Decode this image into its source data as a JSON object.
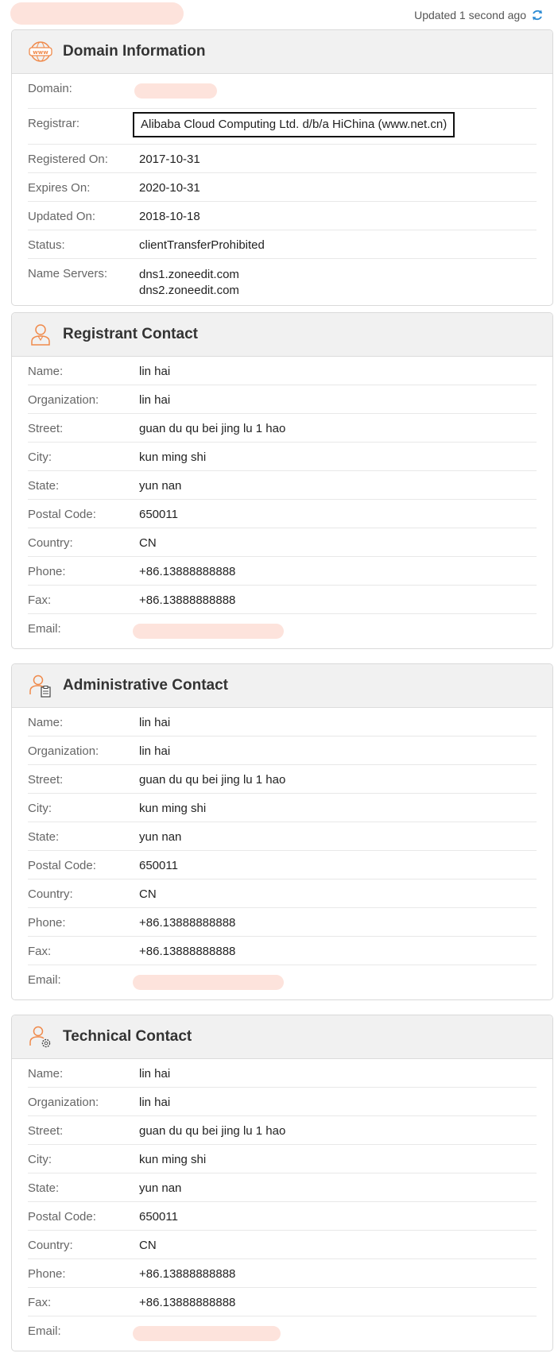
{
  "header": {
    "updated_text": "Updated 1 second ago",
    "refresh_icon": "refresh-icon"
  },
  "colors": {
    "accent": "#f08a4b",
    "redact": "#fde3dc",
    "refresh": "#2a8ad4"
  },
  "domain_info": {
    "title": "Domain Information",
    "icon": "www-icon",
    "rows": [
      {
        "label": "Domain:",
        "value": ""
      },
      {
        "label": "Registrar:",
        "value": "Alibaba Cloud Computing Ltd. d/b/a HiChina (www.net.cn)"
      },
      {
        "label": "Registered On:",
        "value": "2017-10-31"
      },
      {
        "label": "Expires On:",
        "value": "2020-10-31"
      },
      {
        "label": "Updated On:",
        "value": "2018-10-18"
      },
      {
        "label": "Status:",
        "value": "clientTransferProhibited"
      },
      {
        "label": "Name Servers:",
        "values": [
          "dns1.zoneedit.com",
          "dns2.zoneedit.com"
        ]
      }
    ]
  },
  "registrant": {
    "title": "Registrant Contact",
    "icon": "person-icon",
    "rows": [
      {
        "label": "Name:",
        "value": "lin hai"
      },
      {
        "label": "Organization:",
        "value": "lin hai"
      },
      {
        "label": "Street:",
        "value": "guan du qu bei jing lu 1 hao"
      },
      {
        "label": "City:",
        "value": "kun ming shi"
      },
      {
        "label": "State:",
        "value": "yun nan"
      },
      {
        "label": "Postal Code:",
        "value": "650011"
      },
      {
        "label": "Country:",
        "value": "CN"
      },
      {
        "label": "Phone:",
        "value": "+86.13888888888"
      },
      {
        "label": "Fax:",
        "value": "+86.13888888888"
      },
      {
        "label": "Email:",
        "value": ""
      }
    ]
  },
  "admin": {
    "title": "Administrative Contact",
    "icon": "person-clipboard-icon",
    "rows": [
      {
        "label": "Name:",
        "value": "lin hai"
      },
      {
        "label": "Organization:",
        "value": "lin hai"
      },
      {
        "label": "Street:",
        "value": "guan du qu bei jing lu 1 hao"
      },
      {
        "label": "City:",
        "value": "kun ming shi"
      },
      {
        "label": "State:",
        "value": "yun nan"
      },
      {
        "label": "Postal Code:",
        "value": "650011"
      },
      {
        "label": "Country:",
        "value": "CN"
      },
      {
        "label": "Phone:",
        "value": "+86.13888888888"
      },
      {
        "label": "Fax:",
        "value": "+86.13888888888"
      },
      {
        "label": "Email:",
        "value": ""
      }
    ]
  },
  "tech": {
    "title": "Technical Contact",
    "icon": "person-gear-icon",
    "rows": [
      {
        "label": "Name:",
        "value": "lin hai"
      },
      {
        "label": "Organization:",
        "value": "lin hai"
      },
      {
        "label": "Street:",
        "value": "guan du qu bei jing lu 1 hao"
      },
      {
        "label": "City:",
        "value": "kun ming shi"
      },
      {
        "label": "State:",
        "value": "yun nan"
      },
      {
        "label": "Postal Code:",
        "value": "650011"
      },
      {
        "label": "Country:",
        "value": "CN"
      },
      {
        "label": "Phone:",
        "value": "+86.13888888888"
      },
      {
        "label": "Fax:",
        "value": "+86.13888888888"
      },
      {
        "label": "Email:",
        "value": ""
      }
    ]
  }
}
